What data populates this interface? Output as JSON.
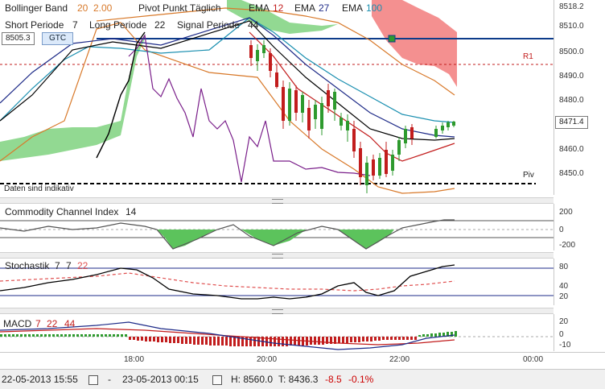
{
  "indicators": {
    "bollinger": {
      "label": "Bollinger Band",
      "p1": "20",
      "p2": "2.00"
    },
    "pivot": {
      "label": "Pivot Punkt Täglich"
    },
    "ema": [
      {
        "label": "EMA",
        "value": "12"
      },
      {
        "label": "EMA",
        "value": "27"
      },
      {
        "label": "EMA",
        "value": "100"
      }
    ],
    "macd_params": {
      "short_label": "Short Periode",
      "short": "7",
      "long_label": "Long Periode",
      "long": "22",
      "signal_label": "Signal Periode",
      "signal": "44"
    }
  },
  "order_line": {
    "price": "8505.3",
    "button": "GTC"
  },
  "main_chart": {
    "pivot_labels": {
      "r1": "R1",
      "piv": "Piv"
    },
    "note": "Daten sind indikativ",
    "current_price": "8471.4",
    "y_ticks": [
      "8518.2",
      "8510.0",
      "8500.0",
      "8490.0",
      "8480.0",
      "8460.0",
      "8450.0"
    ]
  },
  "cci": {
    "label": "Commodity Channel Index",
    "period": "14",
    "ticks": [
      "200",
      "0",
      "-200"
    ]
  },
  "stoch": {
    "label": "Stochastik",
    "p1": "7",
    "p2": "7",
    "p3": "22",
    "ticks": [
      "80",
      "40",
      "20"
    ]
  },
  "macd": {
    "label": "MACD",
    "p1": "7",
    "p2": "22",
    "p3": "44",
    "ticks": [
      "20",
      "0",
      "-10"
    ]
  },
  "time_axis": [
    "18:00",
    "20:00",
    "22:00",
    "00:00"
  ],
  "status": {
    "from": "22-05-2013 15:55",
    "to": "23-05-2013 00:15",
    "high": "H: 8560.0",
    "low": "T: 8436.3",
    "change": "-8.5",
    "change_pct": "-0.1%"
  },
  "colors": {
    "bull": "#2e9a2e",
    "bear": "#c21d1d",
    "cloud": "#7fd27f",
    "resistance": "#f27c7c",
    "order_line": "#0d3c8a",
    "stoch_sig": "#e05050"
  }
}
